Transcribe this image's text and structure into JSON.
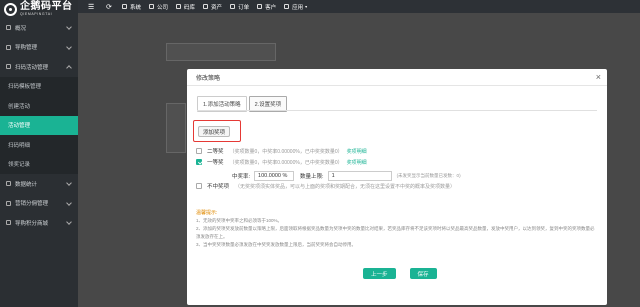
{
  "logo": {
    "name": "企鹅码平台",
    "sub": "QIEMAPINGTAI"
  },
  "topbar": {
    "items": [
      {
        "label": "系统",
        "icon": "monitor-icon"
      },
      {
        "label": "公司",
        "icon": "building-icon"
      },
      {
        "label": "码库",
        "icon": "database-icon"
      },
      {
        "label": "资产",
        "icon": "asset-icon"
      },
      {
        "label": "订单",
        "icon": "order-icon"
      },
      {
        "label": "客户",
        "icon": "user-icon"
      },
      {
        "label": "应用",
        "icon": "grid-icon",
        "caret": "▾"
      }
    ]
  },
  "sidebar": {
    "items": [
      {
        "label": "概况"
      },
      {
        "label": "导购管理"
      },
      {
        "label": "扫码活动管理"
      }
    ],
    "subitems": [
      {
        "label": "扫码模板管理"
      },
      {
        "label": "创建活动"
      },
      {
        "label": "活动管理"
      },
      {
        "label": "扫码明细"
      },
      {
        "label": "领奖记录"
      }
    ],
    "bottom_items": [
      {
        "label": "数据统计"
      },
      {
        "label": "营销分佣管理"
      },
      {
        "label": "导购积分商城"
      }
    ]
  },
  "modal": {
    "title": "修改策略",
    "close": "×",
    "steps": [
      "1.添加活动策略",
      "2.设置奖项"
    ],
    "add_button": "添加奖项",
    "prizes": [
      {
        "name": "二等奖",
        "meta": "（奖项数量0，中奖率0.00000%，已中奖奖数量0）",
        "link": "奖项明细",
        "checked": false
      },
      {
        "name": "一等奖",
        "meta": "（奖项数量0，中奖率0.00000%，已中奖奖数量0）",
        "link": "奖项明细",
        "checked": true
      },
      {
        "name": "不中奖项",
        "meta": "（无奖奖项须实体奖品，可以与上面的奖项和奖期配合，无须在这里设置不中奖的概率及奖项数量）",
        "link": "",
        "checked": false
      }
    ],
    "rate_label": "中奖率:",
    "rate_value": "100.0000 %",
    "limit_label": "数量上限:",
    "limit_value": "1",
    "rate_hint": "(未发奖显示当前数量已发数：0)",
    "tips_title": "温馨提示:",
    "tips": [
      "1、无效的奖项中奖率之和必须等于100%。",
      "2、添加的奖项奖发放前数量以策略上限，后面领取将根据奖品数量为奖项中奖的数量比对结果，若奖品库存将不足该奖项时将以奖品最高奖品数量，发放中奖用户，以达到领奖，复到中奖的奖项数量必须发放存在上。",
      "3、当中奖奖项数量必须发放在中奖奖发放数量上限后，当前奖奖将会自动停用。"
    ],
    "prev_button": "上一步",
    "save_button": "保存"
  },
  "colors": {
    "accent": "#1ab394",
    "sidebar": "#2b2f33",
    "highlight": "#e53935"
  }
}
